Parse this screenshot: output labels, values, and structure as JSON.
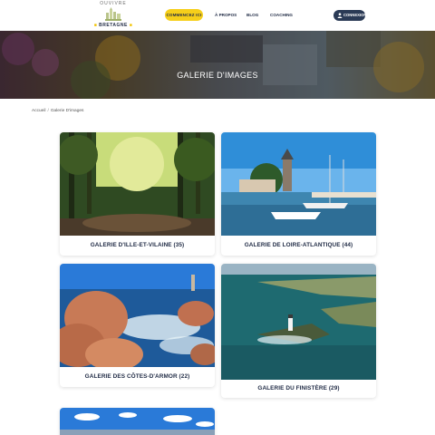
{
  "header": {
    "logo": {
      "top": "OUVIVRE",
      "bottom": "BRETAGNE"
    },
    "start_button": "COMMENCEZ ICI",
    "nav": [
      {
        "label": "À PROPOS"
      },
      {
        "label": "BLOG"
      },
      {
        "label": "COACHING"
      }
    ],
    "login_button": "CONNEXION"
  },
  "hero": {
    "title": "GALERIE D'IMAGES"
  },
  "breadcrumb": {
    "home": "Accueil",
    "separator": "/",
    "current": "Galerie D'images"
  },
  "galleries": [
    {
      "title": "GALERIE D'ILLE-ET-VILAINE (35)"
    },
    {
      "title": "GALERIE DE LOIRE-ATLANTIQUE (44)"
    },
    {
      "title": "GALERIE DES CÔTES-D'ARMOR (22)"
    },
    {
      "title": "GALERIE DU FINISTÈRE (29)"
    }
  ],
  "colors": {
    "accent": "#f6cf1a",
    "navy": "#1f2a44",
    "login": "#2a3a55"
  }
}
